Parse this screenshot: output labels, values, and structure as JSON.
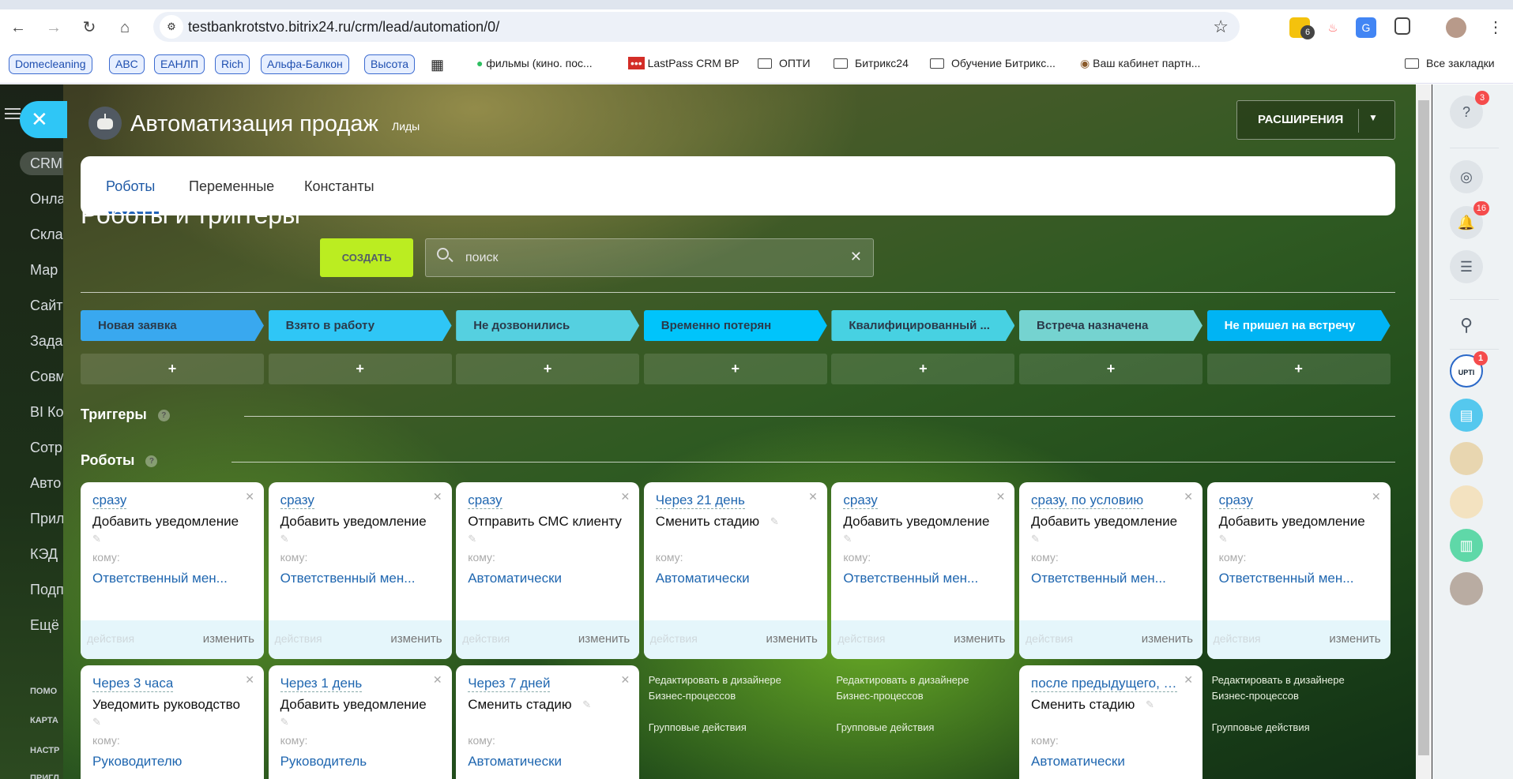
{
  "browser": {
    "url": "testbankrotstvo.bitrix24.ru/crm/lead/automation/0/",
    "ext_badge": "6",
    "bookmark_pills": [
      "Domecleaning",
      "ABC",
      "ЕАНЛП",
      "Rich",
      "Альфа-Балкон",
      "Высота"
    ],
    "bookmarks": [
      "фильмы (кино. пос...",
      "LastPass CRM BP",
      "ОПТИ",
      "Битрикс24",
      "Обучение Битрикс...",
      "Ваш кабинет партн..."
    ],
    "all_bookmarks": "Все закладки"
  },
  "leftnav": {
    "items": [
      "CRM",
      "Онла",
      "Скла",
      "Мар",
      "Сайт",
      "Зада",
      "Совм",
      "BI Ко",
      "Сотр",
      "Авто",
      "Прил",
      "КЭД",
      "Подп",
      "Ещё"
    ],
    "small": [
      "ПОМО",
      "КАРТА",
      "НАСТР",
      "ПРИГЛ"
    ]
  },
  "header": {
    "title": "Автоматизация продаж",
    "subtitle": "Лиды",
    "extensions": "РАСШИРЕНИЯ"
  },
  "tabs": [
    "Роботы",
    "Переменные",
    "Константы"
  ],
  "section": {
    "title": "Роботы и триггеры",
    "create": "СОЗДАТЬ",
    "search_placeholder": "поиск",
    "triggers": "Триггеры",
    "robots": "Роботы"
  },
  "stages": [
    {
      "name": "Новая заявка",
      "color": "#39a8ef",
      "text": "#2b3a4a"
    },
    {
      "name": "Взято в работу",
      "color": "#2fc6f6",
      "text": "#2b3a4a"
    },
    {
      "name": "Не дозвонились",
      "color": "#55d0e0",
      "text": "#2b3a4a"
    },
    {
      "name": "Временно потерян",
      "color": "#00c4fb",
      "text": "#2b3a4a"
    },
    {
      "name": "Квалифицированный ...",
      "color": "#47d1e2",
      "text": "#2b3a4a"
    },
    {
      "name": "Встреча назначена",
      "color": "#75d3d0",
      "text": "#2b3a4a"
    },
    {
      "name": "Не пришел на встречу",
      "color": "#00b4f4",
      "text": "#ffffff"
    }
  ],
  "card_labels": {
    "to": "кому:",
    "actions": "действия",
    "edit": "изменить"
  },
  "robots_row1": [
    {
      "when": "сразу",
      "action": "Добавить уведомление",
      "target": "Ответственный мен..."
    },
    {
      "when": "сразу",
      "action": "Добавить уведомление",
      "target": "Ответственный мен..."
    },
    {
      "when": "сразу",
      "action": "Отправить СМС клиенту",
      "target": "Автоматически"
    },
    {
      "when": "Через 21 день",
      "action": "Сменить стадию",
      "target": "Автоматически",
      "inline_pen": true
    },
    {
      "when": "сразу",
      "action": "Добавить уведомление",
      "target": "Ответственный мен..."
    },
    {
      "when": "сразу, по условию",
      "action": "Добавить уведомление",
      "target": "Ответственный мен..."
    },
    {
      "when": "сразу",
      "action": "Добавить уведомление",
      "target": "Ответственный мен..."
    }
  ],
  "robots_row2": [
    {
      "col": 0,
      "when": "Через 3 часа",
      "action": "Уведомить руководство",
      "target": "Руководителю"
    },
    {
      "col": 1,
      "when": "Через 1 день",
      "action": "Добавить уведомление",
      "target": "Руководитель"
    },
    {
      "col": 2,
      "when": "Через 7 дней",
      "action": "Сменить стадию",
      "target": "Автоматически",
      "inline_pen": true
    },
    {
      "col": 5,
      "when": "после предыдущего, п...",
      "action": "Сменить стадию",
      "target": "Автоматически",
      "inline_pen": true
    }
  ],
  "column_links": {
    "cols": [
      3,
      4,
      6
    ],
    "edit_line1": "Редактировать в дизайнере",
    "edit_line2": "Бизнес-процессов",
    "group": "Групповые действия"
  },
  "right_panel": {
    "help_badge": "3",
    "notif_badge": "16",
    "upti_badge": "1",
    "upti_label": "UPTI"
  }
}
